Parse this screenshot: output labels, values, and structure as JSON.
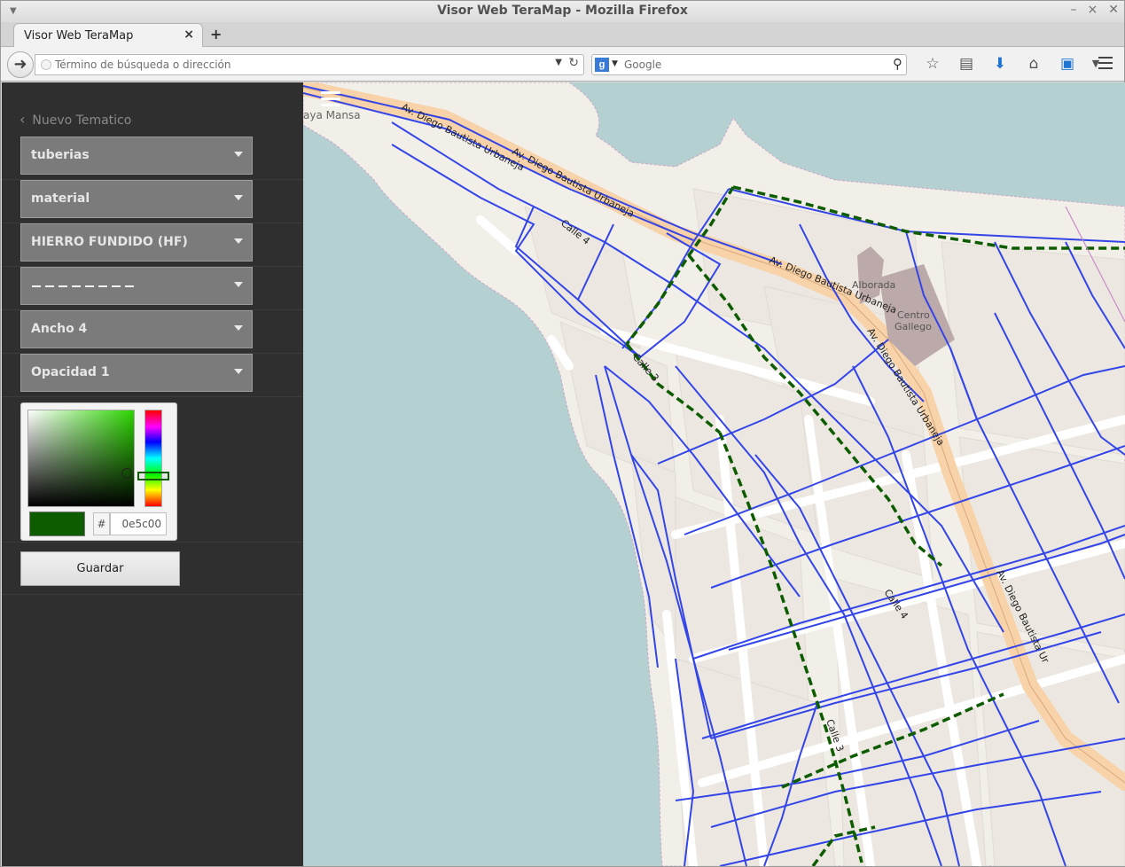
{
  "window": {
    "title": "Visor Web TeraMap - Mozilla Firefox",
    "controls": [
      "–",
      "×",
      "✕"
    ]
  },
  "tabs": [
    {
      "label": "Visor Web TeraMap"
    }
  ],
  "navbar": {
    "url_placeholder": "Término de búsqueda o dirección",
    "search_engine": "g",
    "search_placeholder": "Google"
  },
  "sidebar": {
    "back_label": "Nuevo Tematico",
    "selects": [
      {
        "label": "tuberias"
      },
      {
        "label": "material"
      },
      {
        "label": "HIERRO FUNDIDO (HF)"
      },
      {
        "label": "",
        "style": "dashed-line"
      },
      {
        "label": "Ancho 4"
      },
      {
        "label": "Opacidad 1"
      }
    ],
    "color_picker": {
      "hash": "#",
      "hex_value": "0e5c00",
      "selected_color": "#0e5c00"
    },
    "save_label": "Guardar"
  },
  "map": {
    "labels": {
      "playa_mansa": "aya Mansa",
      "av_diego_1": "Av. Diego Bautista Urbaneja",
      "av_diego_2": "Av. Diego Bautista Urbaneja",
      "av_diego_3": "Av. Diego Bautista Urbaneja",
      "av_diego_4": "Av. Diego Bautista Urbaneja",
      "av_diego_5": "Av. Diego Bautista Ur",
      "calle4_a": "Calle 4",
      "calle3_a": "Calle 3",
      "calle4_b": "Calle 4",
      "calle3_b": "Calle 3",
      "alborada": "Alborada",
      "centro_gallego_1": "Centro",
      "centro_gallego_2": "Gallego"
    },
    "colors": {
      "water": "#b5d0d0",
      "land": "#f2efe9",
      "block": "#ece8e1",
      "pipe": "#3345e8",
      "thematic": "#0e5c00",
      "avenue": "#f8d2a8",
      "building": "#bca9a9"
    }
  }
}
